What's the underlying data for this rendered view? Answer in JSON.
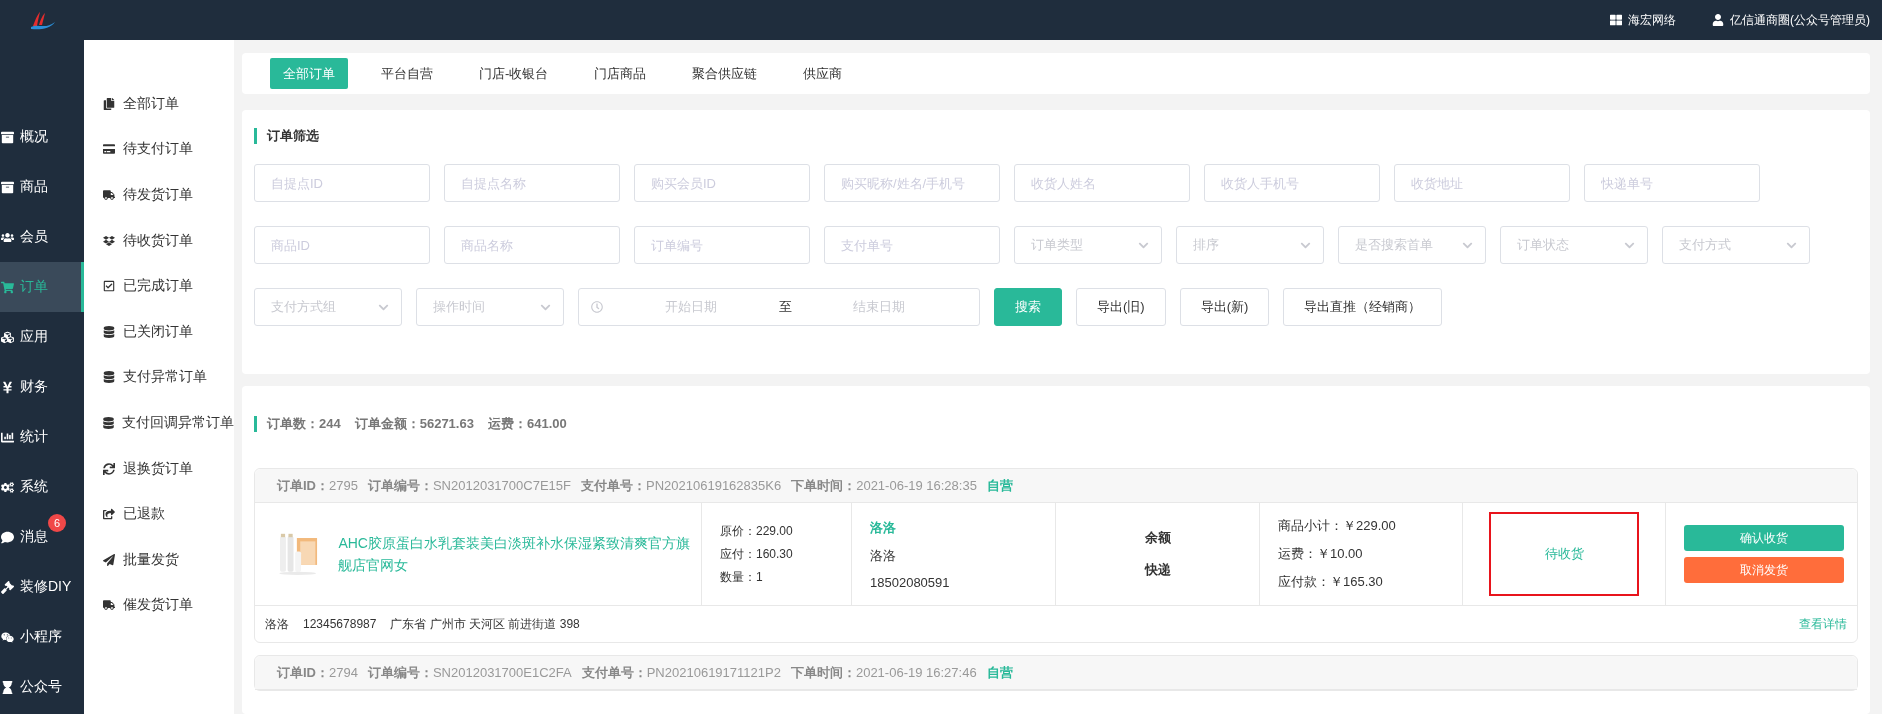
{
  "topbar": {
    "org": "海宏网络",
    "user": "亿信通商圈(公众号管理员)"
  },
  "nav": [
    {
      "label": "概况",
      "selected": false
    },
    {
      "label": "商品",
      "selected": false
    },
    {
      "label": "会员",
      "selected": false
    },
    {
      "label": "订单",
      "selected": true
    },
    {
      "label": "应用",
      "selected": false
    },
    {
      "label": "财务",
      "selected": false
    },
    {
      "label": "统计",
      "selected": false
    },
    {
      "label": "系统",
      "selected": false
    },
    {
      "label": "消息",
      "selected": false,
      "badge": "6"
    },
    {
      "label": "装修DIY",
      "selected": false
    },
    {
      "label": "小程序",
      "selected": false
    },
    {
      "label": "公众号",
      "selected": false
    }
  ],
  "subnav": [
    "全部订单",
    "待支付订单",
    "待发货订单",
    "待收货订单",
    "已完成订单",
    "已关闭订单",
    "支付异常订单",
    "支付回调异常订单",
    "退换货订单",
    "已退款",
    "批量发货",
    "催发货订单"
  ],
  "tabs": [
    {
      "label": "全部订单",
      "selected": true
    },
    {
      "label": "平台自营",
      "selected": false
    },
    {
      "label": "门店-收银台",
      "selected": false
    },
    {
      "label": "门店商品",
      "selected": false
    },
    {
      "label": "聚合供应链",
      "selected": false
    },
    {
      "label": "供应商",
      "selected": false
    }
  ],
  "filter": {
    "title": "订单筛选",
    "rows": [
      [
        {
          "kind": "input",
          "placeholder": "自提点ID"
        },
        {
          "kind": "input",
          "placeholder": "自提点名称"
        },
        {
          "kind": "input",
          "placeholder": "购买会员ID"
        },
        {
          "kind": "input",
          "placeholder": "购买昵称/姓名/手机号"
        },
        {
          "kind": "input",
          "placeholder": "收货人姓名"
        },
        {
          "kind": "input",
          "placeholder": "收货人手机号"
        },
        {
          "kind": "input",
          "placeholder": "收货地址"
        },
        {
          "kind": "input",
          "placeholder": "快递单号"
        }
      ],
      [
        {
          "kind": "input",
          "placeholder": "商品ID"
        },
        {
          "kind": "input",
          "placeholder": "商品名称"
        },
        {
          "kind": "input",
          "placeholder": "订单编号"
        },
        {
          "kind": "input",
          "placeholder": "支付单号"
        },
        {
          "kind": "select",
          "placeholder": "订单类型"
        },
        {
          "kind": "select",
          "placeholder": "排序"
        },
        {
          "kind": "select",
          "placeholder": "是否搜索首单"
        },
        {
          "kind": "select",
          "placeholder": "订单状态"
        },
        {
          "kind": "select",
          "placeholder": "支付方式"
        }
      ],
      [
        {
          "kind": "select",
          "placeholder": "支付方式组"
        },
        {
          "kind": "select",
          "placeholder": "操作时间"
        },
        {
          "kind": "daterange",
          "start": "开始日期",
          "separator": "至",
          "end": "结束日期"
        },
        {
          "kind": "primary",
          "label": "搜索"
        },
        {
          "kind": "button",
          "label": "导出(旧)"
        },
        {
          "kind": "button",
          "label": "导出(新)"
        },
        {
          "kind": "button",
          "label": "导出直推（经销商）"
        }
      ]
    ]
  },
  "stats": [
    "订单数：244",
    "订单金额：56271.63",
    "运费：641.00"
  ],
  "orders": [
    {
      "header": [
        {
          "label": "订单ID：",
          "value": "2795"
        },
        {
          "label": "订单编号：",
          "value": "SN2012031700C7E15F"
        },
        {
          "label": "支付单号：",
          "value": "PN20210619162835K6"
        },
        {
          "label": "下单时间：",
          "value": "2021-06-19 16:28:35"
        }
      ],
      "tag": "自营",
      "product": {
        "kind": "picture",
        "name": "AHC胶原蛋白水乳套装美白淡斑补水保湿紧致清爽官方旗舰店官网女"
      },
      "price_lines": [
        "原价：229.00",
        "应付：160.30",
        "数量：1"
      ],
      "buyer": {
        "nickname": "洛洛",
        "name": "洛洛",
        "phone": "18502080591"
      },
      "payment": [
        "余额",
        "快递"
      ],
      "totals": [
        "商品小计：￥229.00",
        "运费：￥10.00",
        "应付款：￥165.30"
      ],
      "status": "待收货",
      "highlighted": true,
      "actions": [
        {
          "label": "确认收货",
          "kind": "confirm"
        },
        {
          "label": "取消发货",
          "kind": "cancel"
        }
      ],
      "address": [
        "洛洛",
        "12345678987",
        "广东省 广州市 天河区 前进街道 398"
      ],
      "detail_link": "查看详情"
    },
    {
      "header": [
        {
          "label": "订单ID：",
          "value": "2794"
        },
        {
          "label": "订单编号：",
          "value": "SN2012031700E1C2FA"
        },
        {
          "label": "支付单号：",
          "value": "PN20210619171121P2"
        },
        {
          "label": "下单时间：",
          "value": "2021-06-19 16:27:46"
        }
      ],
      "tag": "自营"
    }
  ]
}
